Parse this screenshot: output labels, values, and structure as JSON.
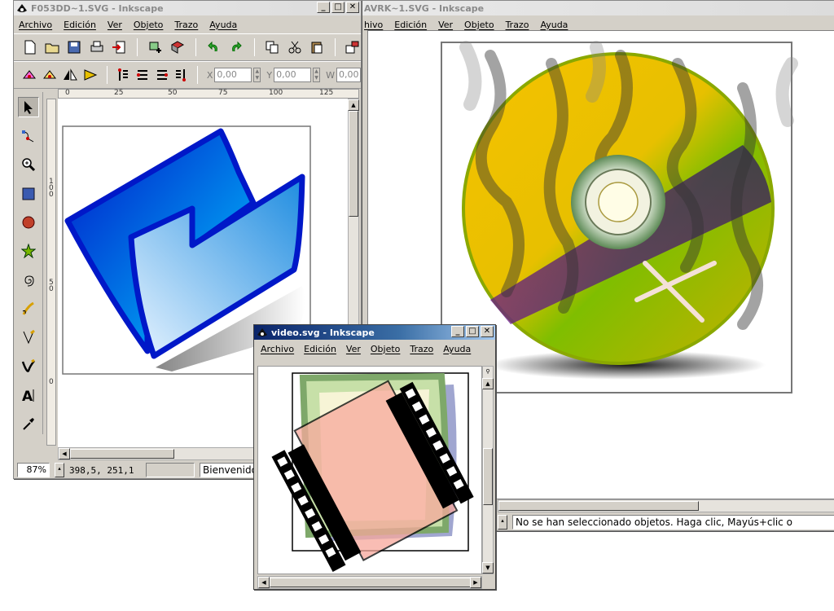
{
  "menu": [
    "Archivo",
    "Edición",
    "Ver",
    "Objeto",
    "Trazo",
    "Ayuda"
  ],
  "win_folder": {
    "title": "F053DD~1.SVG - Inkscape",
    "x_label": "X",
    "x_value": "0,00",
    "y_label": "Y",
    "y_value": "0,00",
    "w_label": "W",
    "w_value": "0,00",
    "ruler_top": [
      "0",
      "25",
      "50",
      "75",
      "100",
      "125"
    ],
    "ruler_left": [
      "1",
      "0",
      "0",
      "5",
      "0",
      "0"
    ],
    "zoom": "87%",
    "coords": "398,5, 251,1",
    "status": "Bienvenido"
  },
  "win_cd": {
    "title_fragment": "AVRK~1.SVG - Inkscape",
    "menu_first_fragment": "hivo",
    "status": "No se han seleccionado objetos. Haga clic, Mayús+clic o"
  },
  "win_video": {
    "title": "video.svg - Inkscape"
  },
  "colors": {
    "active_title": "#0a246a",
    "inactive_title": "#e9e9e9",
    "window_face": "#d4d0c8",
    "folder_blue": "#0033cc",
    "cd_yellow": "#f4c400",
    "cd_green": "#4fb200",
    "cd_purple": "#5a2a7a"
  },
  "icons": {
    "toolbox": [
      "selector-arrow-icon",
      "node-edit-icon",
      "zoom-icon",
      "rect-icon",
      "ellipse-icon",
      "star-icon",
      "spiral-icon",
      "pencil-icon",
      "pen-icon",
      "calligraphy-icon",
      "text-icon",
      "dropper-icon"
    ]
  }
}
